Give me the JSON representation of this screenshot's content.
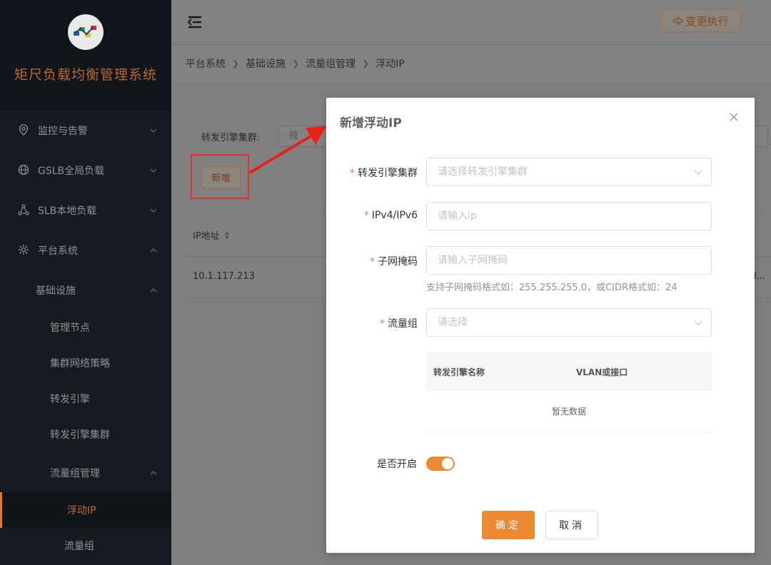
{
  "sidebar": {
    "app_title": "矩尺负载均衡管理系统",
    "menus": [
      {
        "label": "监控与告警",
        "icon": "location-pin-icon"
      },
      {
        "label": "GSLB全局负载",
        "icon": "globe-icon"
      },
      {
        "label": "SLB本地负载",
        "icon": "network-nodes-icon"
      },
      {
        "label": "平台系统",
        "icon": "gear-icon"
      }
    ],
    "sub_group": "基础设施",
    "sub_items": [
      "管理节点",
      "集群网络策略",
      "转发引擎",
      "转发引擎集群"
    ],
    "sub_group2": "流量组管理",
    "sub_items2": [
      "浮动IP",
      "流量组"
    ],
    "active_item": "浮动IP"
  },
  "header": {
    "change_button": "变更执行"
  },
  "breadcrumb": [
    "平台系统",
    "基础设施",
    "流量组管理",
    "浮动IP"
  ],
  "filter": {
    "label": "转发引擎集群:",
    "input_placeholder_visible": "按",
    "add_button": "新增"
  },
  "table": {
    "header_ip": "IP地址",
    "rows": [
      {
        "ip": "10.1.117.213",
        "trunc": "l..."
      }
    ]
  },
  "modal": {
    "title": "新增浮动IP",
    "fields": {
      "cluster": {
        "label": "转发引擎集群",
        "placeholder": "请选择转发引擎集群"
      },
      "ip": {
        "label": "IPv4/IPv6",
        "placeholder": "请输入ip"
      },
      "mask": {
        "label": "子网掩码",
        "placeholder": "请输入子网掩码",
        "hint": "支持子网掩码格式如：255.255.255.0，或CIDR格式如：24"
      },
      "group": {
        "label": "流量组",
        "placeholder": "请选择"
      }
    },
    "subtable": {
      "col1": "转发引擎名称",
      "col2": "VLAN或接口",
      "empty": "暂无数据"
    },
    "switch_label": "是否开启",
    "switch_on": true,
    "ok": "确定",
    "cancel": "取消"
  },
  "colors": {
    "accent": "#ec8a34",
    "highlight_box": "#e0312a",
    "sidebar_bg": "#161b22"
  }
}
